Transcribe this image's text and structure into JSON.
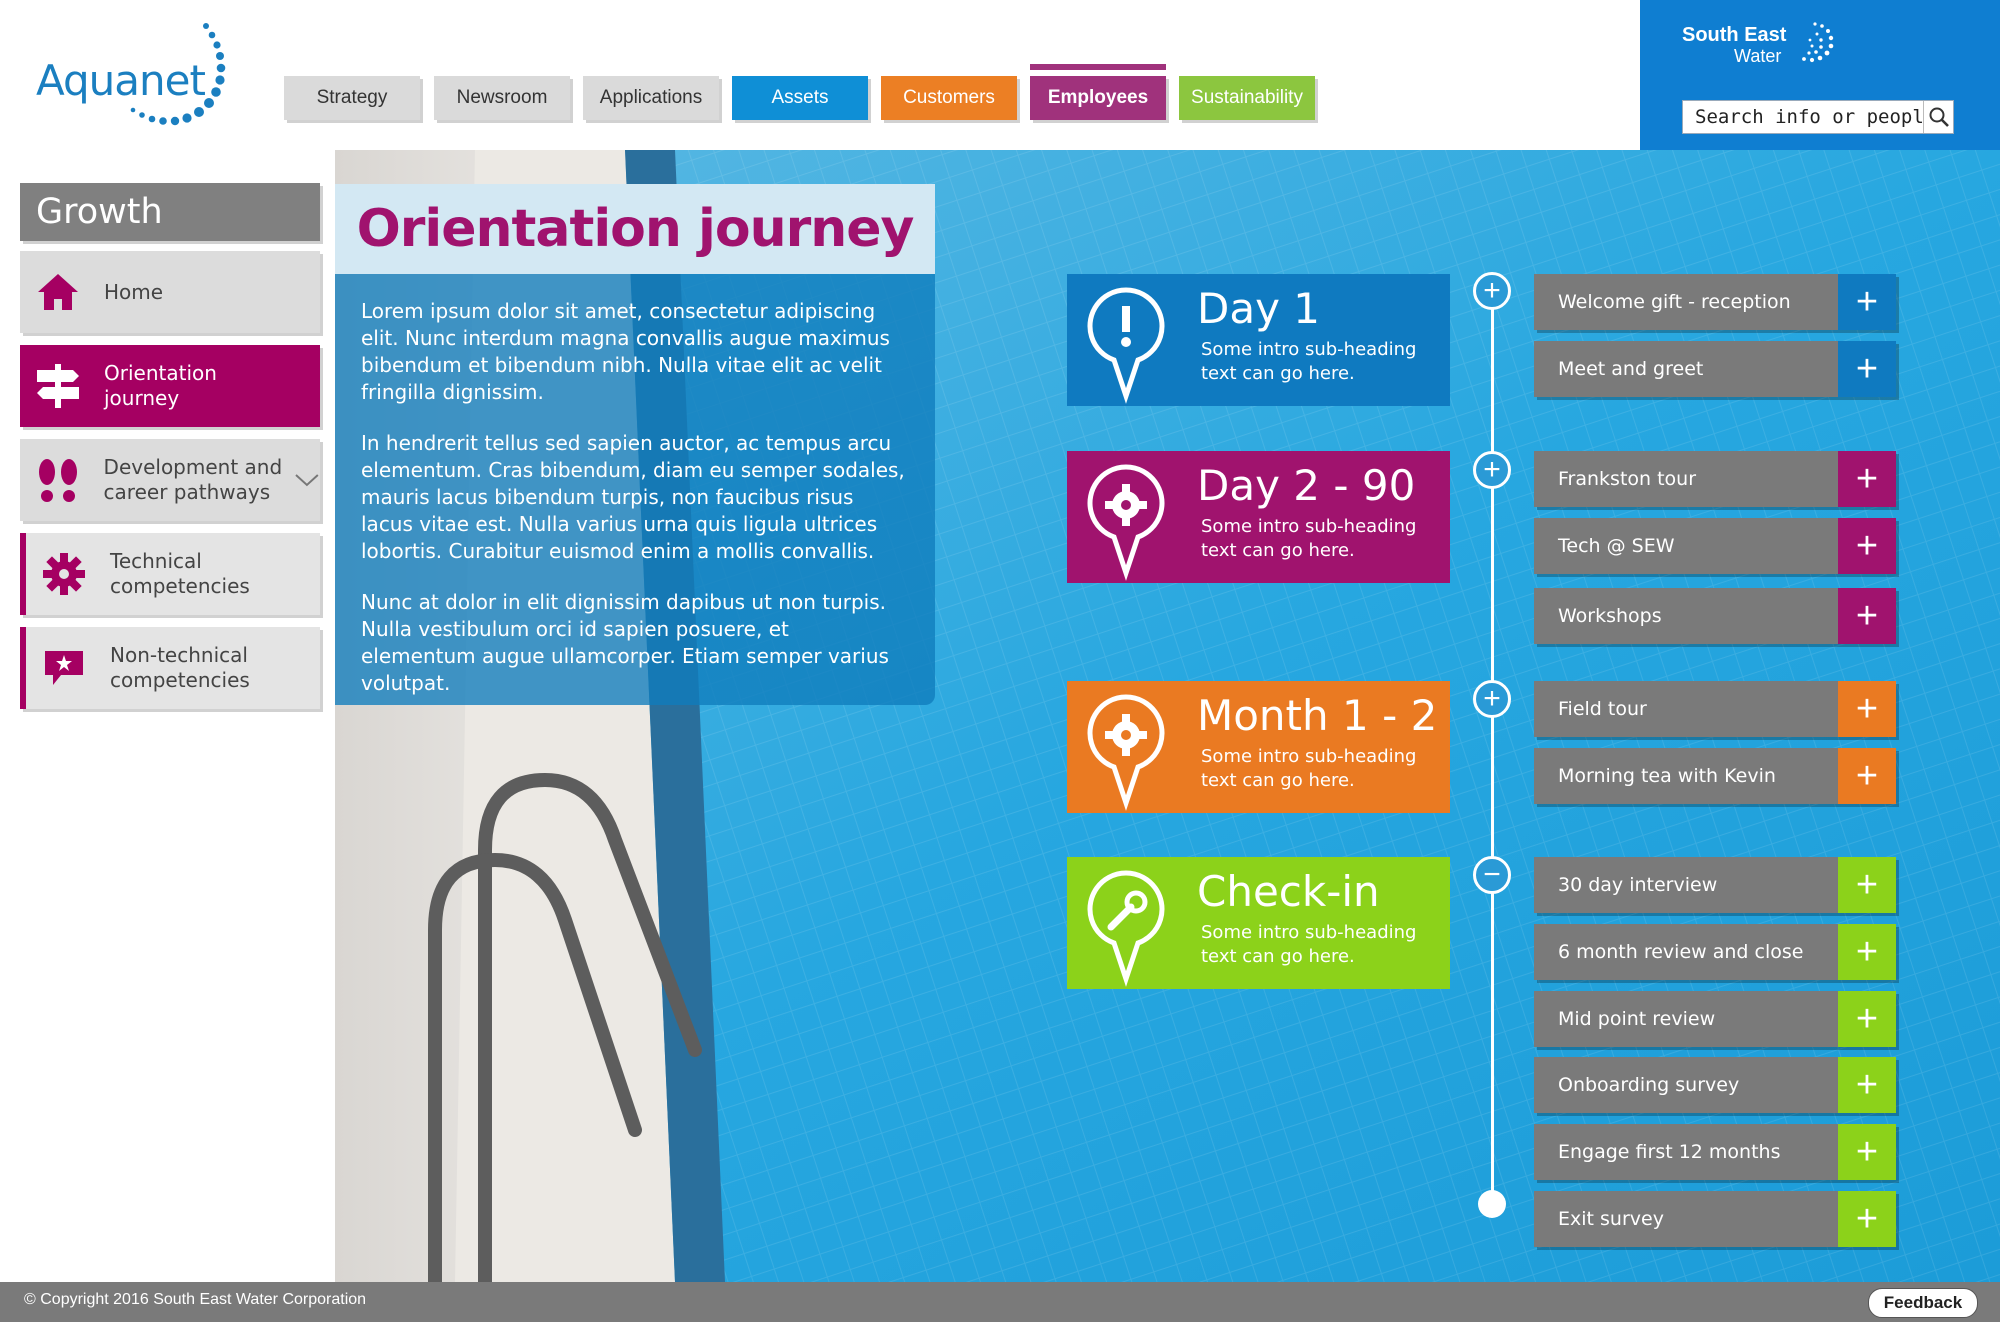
{
  "header": {
    "logo_text": "Aquanet",
    "nav": [
      {
        "label": "Strategy",
        "style": "gray"
      },
      {
        "label": "Newsroom",
        "style": "gray"
      },
      {
        "label": "Applications",
        "style": "gray"
      },
      {
        "label": "Assets",
        "style": "blue"
      },
      {
        "label": "Customers",
        "style": "orange"
      },
      {
        "label": "Employees",
        "style": "purple",
        "active": true
      },
      {
        "label": "Sustainability",
        "style": "green"
      }
    ],
    "brand": {
      "line1": "South East",
      "line2": "Water"
    },
    "search": {
      "placeholder": "Search info or people..."
    }
  },
  "sidebar": {
    "title": "Growth",
    "items": [
      {
        "label": "Home",
        "icon": "home-icon"
      },
      {
        "label": "Orientation journey",
        "icon": "signpost-icon",
        "active": true
      },
      {
        "label": "Development and career pathways",
        "icon": "footprints-icon",
        "expandable": true
      },
      {
        "label": "Technical competencies",
        "icon": "gear-icon",
        "sub": true
      },
      {
        "label": "Non-technical competencies",
        "icon": "speech-star-icon",
        "sub": true
      }
    ]
  },
  "intro": {
    "title": "Orientation journey",
    "paragraphs": [
      "Lorem ipsum dolor sit amet, consectetur adipiscing elit. Nunc interdum magna convallis augue maximus bibendum et bibendum nibh. Nulla vitae elit ac velit fringilla dignissim.",
      "In hendrerit tellus sed sapien auctor, ac tempus arcu elementum. Cras bibendum, diam eu semper sodales, mauris lacus bibendum turpis, non faucibus risus lacus vitae est. Nulla varius urna quis ligula ultrices lobortis. Curabitur euismod enim a mollis convallis.",
      "Nunc at dolor in elit dignissim dapibus ut non turpis. Nulla vestibulum orci id sapien posuere, et elementum augue ullamcorper. Etiam semper varius volutpat."
    ]
  },
  "stages": [
    {
      "title": "Day 1",
      "sub": "Some intro sub-heading text can go here.",
      "color": "#0f7ac0",
      "icon": "exclamation-pin-icon",
      "node": "+"
    },
    {
      "title": "Day 2 - 90",
      "sub": "Some intro sub-heading text can go here.",
      "color": "#a0136e",
      "icon": "gear-pin-icon",
      "node": "+"
    },
    {
      "title": "Month 1 - 2",
      "sub": "Some intro sub-heading text can go here.",
      "color": "#ea7a22",
      "icon": "gear-pin-icon",
      "node": "+"
    },
    {
      "title": "Check-in",
      "sub": "Some intro sub-heading text can go here.",
      "color": "#8cd21a",
      "icon": "wrench-pin-icon",
      "node": "−"
    }
  ],
  "tasks": [
    {
      "label": "Welcome gift - reception",
      "stage": 0
    },
    {
      "label": "Meet and greet",
      "stage": 0
    },
    {
      "label": "Frankston tour",
      "stage": 1
    },
    {
      "label": "Tech @ SEW",
      "stage": 1
    },
    {
      "label": "Workshops",
      "stage": 1
    },
    {
      "label": "Field tour",
      "stage": 2
    },
    {
      "label": "Morning tea with Kevin",
      "stage": 2
    },
    {
      "label": "30 day interview",
      "stage": 3
    },
    {
      "label": "6 month review and close",
      "stage": 3
    },
    {
      "label": "Mid point review",
      "stage": 3
    },
    {
      "label": "Onboarding survey",
      "stage": 3
    },
    {
      "label": "Engage first 12 months",
      "stage": 3
    },
    {
      "label": "Exit survey",
      "stage": 3
    }
  ],
  "task_button": "+",
  "footer": {
    "copyright": "© Copyright 2016 South East Water Corporation",
    "feedback": "Feedback"
  }
}
